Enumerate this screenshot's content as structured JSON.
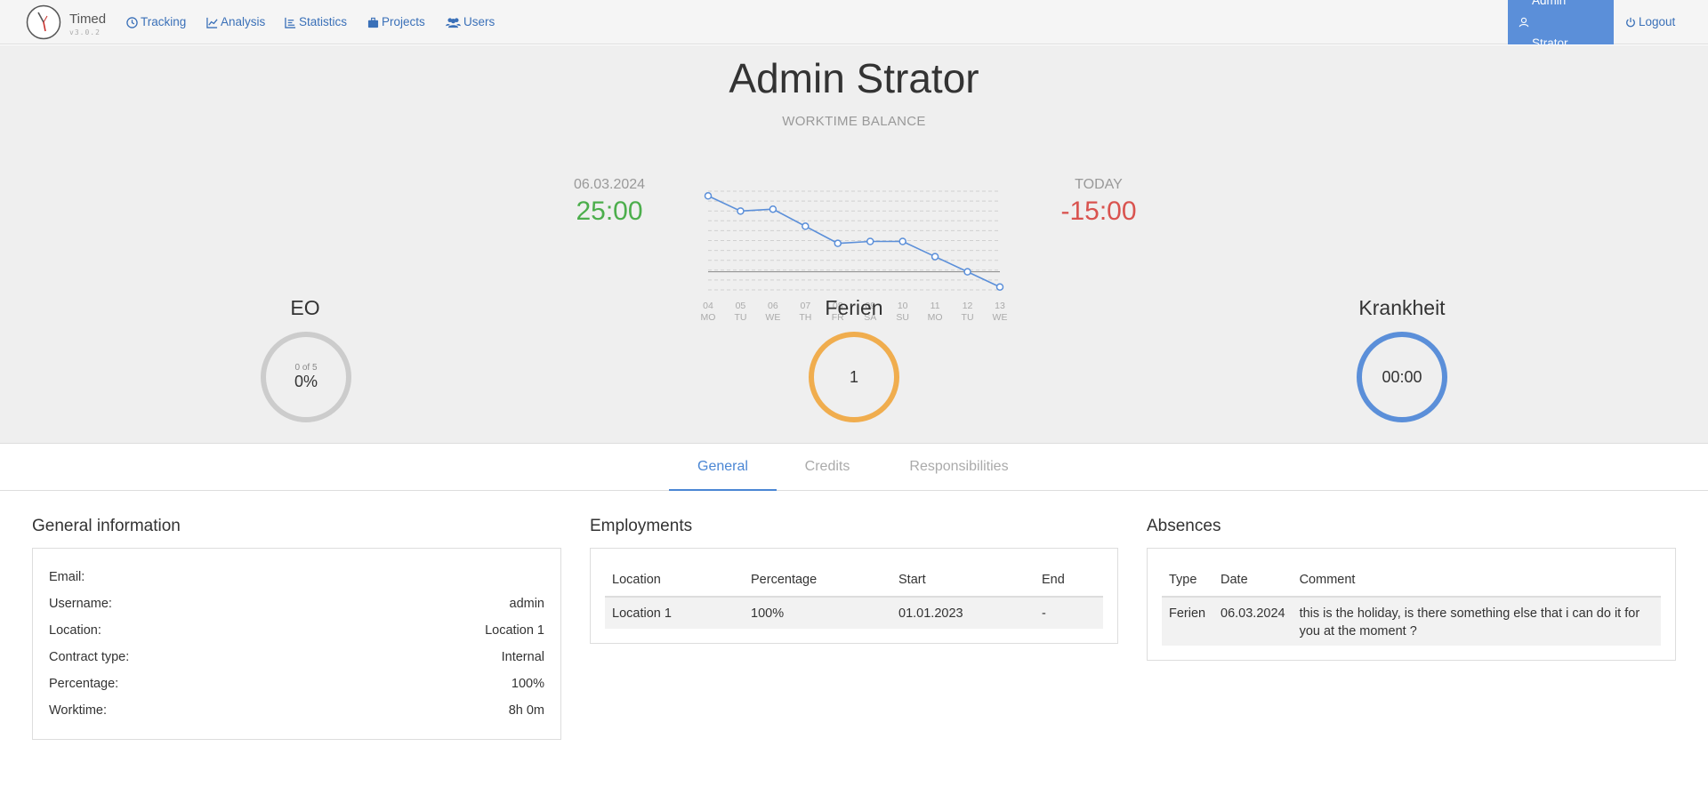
{
  "app": {
    "name": "Timed",
    "version": "v3.0.2"
  },
  "nav": {
    "items": [
      {
        "label": "Tracking",
        "icon": "clock-icon"
      },
      {
        "label": "Analysis",
        "icon": "line-chart-icon"
      },
      {
        "label": "Statistics",
        "icon": "bar-chart-icon"
      },
      {
        "label": "Projects",
        "icon": "briefcase-icon"
      },
      {
        "label": "Users",
        "icon": "users-icon"
      }
    ],
    "user_label": "Admin Strator",
    "logout_label": "Logout"
  },
  "colors": {
    "accent": "#5b8fd9",
    "positive": "#4cae4c",
    "negative": "#d9534f",
    "eo_ring": "#cccccc",
    "ferien_ring": "#f0ad4e",
    "krankheit_ring": "#5b8fd9"
  },
  "page": {
    "title": "Admin Strator",
    "worktime_balance_label": "WORKTIME BALANCE",
    "left_date": "06.03.2024",
    "left_balance": "25:00",
    "right_label": "TODAY",
    "right_balance": "-15:00"
  },
  "chart_data": {
    "type": "line",
    "categories": [
      "04",
      "05",
      "06",
      "07",
      "08",
      "09",
      "10",
      "11",
      "12",
      "13"
    ],
    "weekdays": [
      "MO",
      "TU",
      "WE",
      "TH",
      "FR",
      "SA",
      "SU",
      "MO",
      "TU",
      "WE"
    ],
    "values": [
      40,
      32,
      33,
      24,
      15,
      16,
      16,
      8,
      0,
      -8
    ],
    "ylim": [
      -10,
      42
    ],
    "grid": true,
    "zero_line": true
  },
  "stats": [
    {
      "title": "EO",
      "small": "0 of 5",
      "value": "0%"
    },
    {
      "title": "Ferien",
      "small": "",
      "value": "1"
    },
    {
      "title": "Krankheit",
      "small": "",
      "value": "00:00"
    }
  ],
  "tabs": [
    {
      "label": "General",
      "active": true
    },
    {
      "label": "Credits",
      "active": false
    },
    {
      "label": "Responsibilities",
      "active": false
    }
  ],
  "general": {
    "title": "General information",
    "rows": [
      {
        "key": "Email:",
        "value": ""
      },
      {
        "key": "Username:",
        "value": "admin"
      },
      {
        "key": "Location:",
        "value": "Location 1"
      },
      {
        "key": "Contract type:",
        "value": "Internal"
      },
      {
        "key": "Percentage:",
        "value": "100%"
      },
      {
        "key": "Worktime:",
        "value": "8h 0m"
      }
    ]
  },
  "employments": {
    "title": "Employments",
    "headers": [
      "Location",
      "Percentage",
      "Start",
      "End"
    ],
    "rows": [
      [
        "Location 1",
        "100%",
        "01.01.2023",
        "-"
      ]
    ]
  },
  "absences": {
    "title": "Absences",
    "headers": [
      "Type",
      "Date",
      "Comment"
    ],
    "rows": [
      [
        "Ferien",
        "06.03.2024",
        "this is the holiday, is there something else that i can do it for you at the moment ?"
      ]
    ]
  }
}
